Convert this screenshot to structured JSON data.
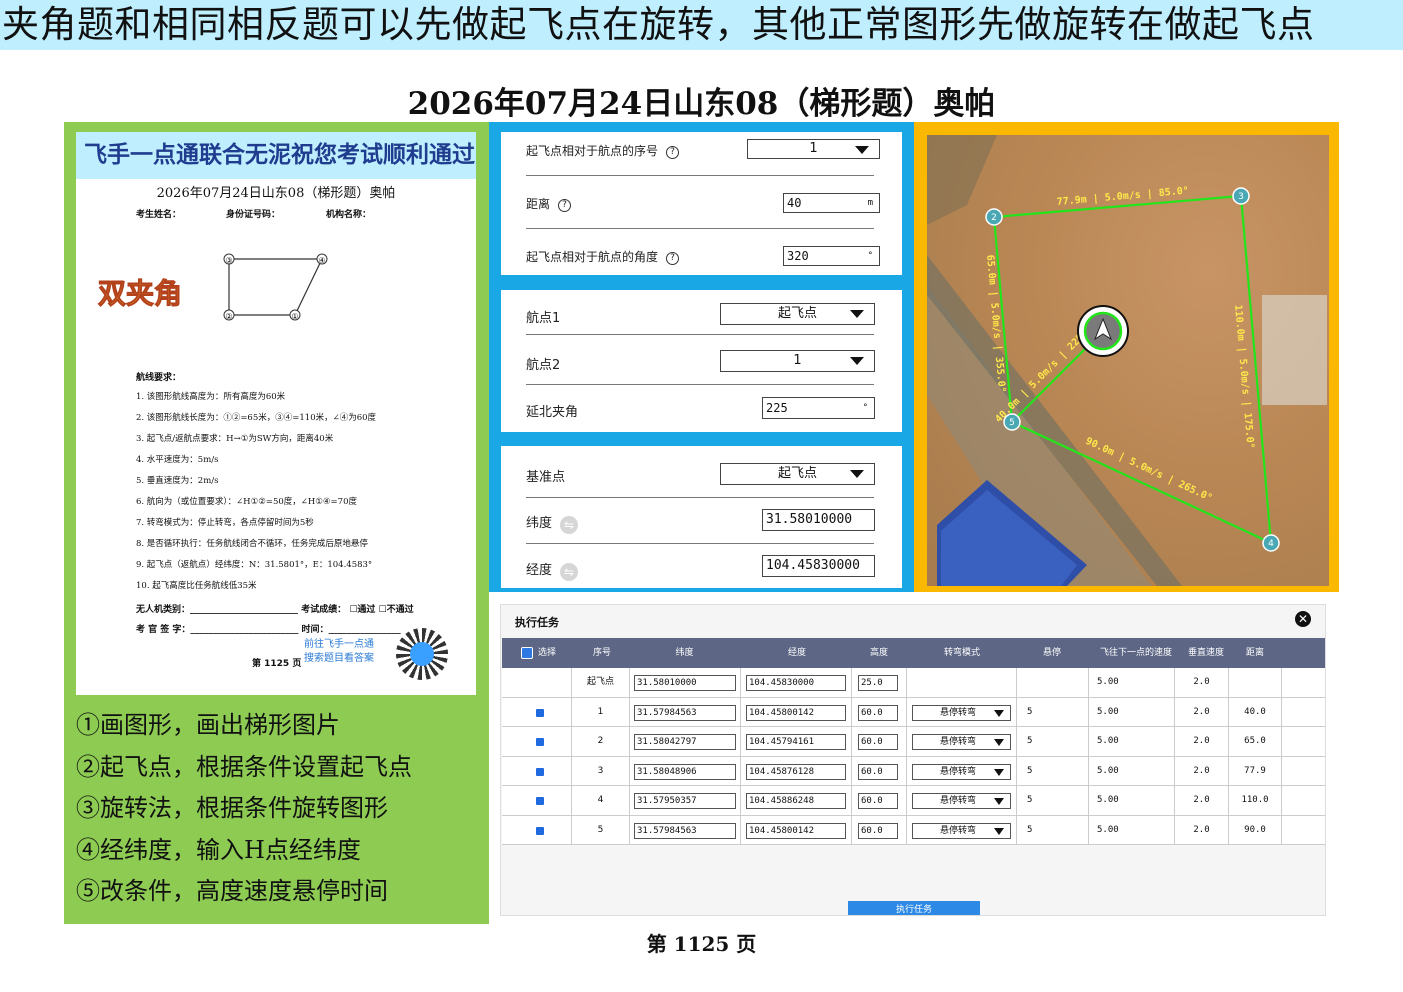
{
  "banner": "夹角题和相同相反题可以先做起飞点在旋转，其他正常图形先做旋转在做起飞点",
  "main_title": "2026年07月24日山东08（梯形题）奥帕",
  "paper": {
    "header": "飞手一点通联合无泥祝您考试顺利通过",
    "title": "2026年07月24日山东08（梯形题）奥帕",
    "field_name": "考生姓名：",
    "field_id": "身份证号码：",
    "field_org": "机构名称：",
    "tag": "双夹角",
    "points": [
      "③",
      "④",
      "②",
      "①"
    ],
    "req_title": "航线要求：",
    "requirements": [
      "1.  该图形航线高度为：所有高度为60米",
      "2.  该图形航线长度为：①②=65米，③④=110米，∠④为60度",
      "3.  起飞点/返航点要求：H→①为SW方向，距离40米",
      "4.  水平速度为：5m/s",
      "5.  垂直速度为：2m/s",
      "6.  航向为（或位置要求）：∠H①②=50度，∠H①④=70度",
      "7.  转弯模式为：停止转弯，各点停留时间为5秒",
      "8.  是否循环执行：任务航线闭合不循环，任务完成后原地悬停",
      "9.  起飞点（返航点）经纬度：N：31.5801°，E：104.4583°",
      "10. 起飞高度比任务航线低35米"
    ],
    "uav_type": "无人机类别：",
    "result": "考试成绩：",
    "pass": "☐通过",
    "fail": "☐不通过",
    "examiner": "考 官 签 字：",
    "time": "时间：",
    "qr_line1": "前往飞手一点通",
    "qr_line2": "搜索题目看答案",
    "page": "第 1125 页"
  },
  "steps": [
    "①画图形，画出梯形图片",
    "②起飞点，根据条件设置起飞点",
    "③旋转法，根据条件旋转图形",
    "④经纬度，输入H点经纬度",
    "⑤改条件，高度速度悬停时间"
  ],
  "settings": {
    "takeoff_seq_label": "起飞点相对于航点的序号",
    "takeoff_seq_value": "1",
    "distance_label": "距离",
    "distance_value": "40",
    "distance_unit": "m",
    "angle_label": "起飞点相对于航点的角度",
    "angle_value": "320",
    "angle_unit": "°",
    "wp1_label": "航点1",
    "wp1_value": "起飞点",
    "wp2_label": "航点2",
    "wp2_value": "1",
    "north_label": "延北夹角",
    "north_value": "225",
    "north_unit": "°",
    "base_label": "基准点",
    "base_value": "起飞点",
    "lat_label": "纬度",
    "lat_value": "31.58010000",
    "lon_label": "经度",
    "lon_value": "104.45830000"
  },
  "map": {
    "points": [
      "1",
      "2",
      "3",
      "4",
      "5"
    ],
    "labels": [
      "77.9m | 5.0m/s | 85.0°",
      "110.0m | 5.0m/s | 175.0°",
      "90.0m | 5.0m/s | 265.0°",
      "65.0m | 5.0m/s | 355.0°",
      "40.0m | 5.0m/s | 225.0°"
    ],
    "line_color": "#22e51a"
  },
  "task": {
    "title": "执行任务",
    "close": "✕",
    "columns": [
      "选择",
      "序号",
      "纬度",
      "经度",
      "高度",
      "转弯模式",
      "悬停",
      "飞往下一点的速度",
      "垂直速度",
      "距离"
    ],
    "rows": [
      {
        "seq": "起飞点",
        "lat": "31.58010000",
        "lon": "104.45830000",
        "alt": "25.0",
        "mode": "",
        "hover": "",
        "speed": "5.00",
        "vspeed": "2.0",
        "dist": ""
      },
      {
        "seq": "1",
        "lat": "31.57984563",
        "lon": "104.45800142",
        "alt": "60.0",
        "mode": "悬停转弯",
        "hover": "5",
        "speed": "5.00",
        "vspeed": "2.0",
        "dist": "40.0"
      },
      {
        "seq": "2",
        "lat": "31.58042797",
        "lon": "104.45794161",
        "alt": "60.0",
        "mode": "悬停转弯",
        "hover": "5",
        "speed": "5.00",
        "vspeed": "2.0",
        "dist": "65.0"
      },
      {
        "seq": "3",
        "lat": "31.58048906",
        "lon": "104.45876128",
        "alt": "60.0",
        "mode": "悬停转弯",
        "hover": "5",
        "speed": "5.00",
        "vspeed": "2.0",
        "dist": "77.9"
      },
      {
        "seq": "4",
        "lat": "31.57950357",
        "lon": "104.45886248",
        "alt": "60.0",
        "mode": "悬停转弯",
        "hover": "5",
        "speed": "5.00",
        "vspeed": "2.0",
        "dist": "110.0"
      },
      {
        "seq": "5",
        "lat": "31.57984563",
        "lon": "104.45800142",
        "alt": "60.0",
        "mode": "悬停转弯",
        "hover": "5",
        "speed": "5.00",
        "vspeed": "2.0",
        "dist": "90.0"
      }
    ],
    "execute": "执行任务"
  },
  "footer": "第 1125 页"
}
